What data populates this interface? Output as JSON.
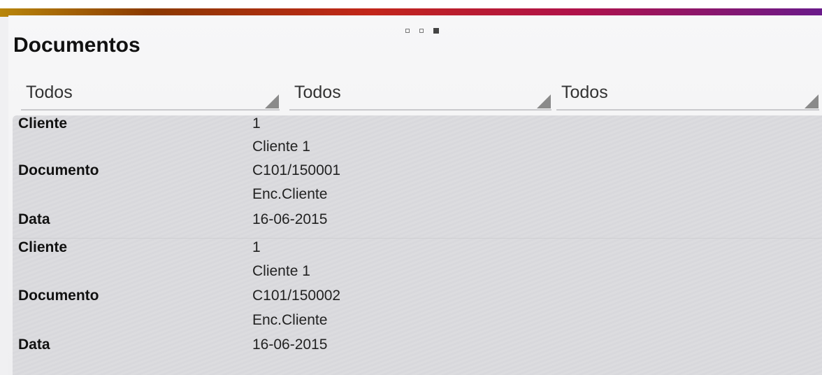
{
  "page_title": "Documentos",
  "filters": [
    "Todos",
    "Todos",
    "Todos"
  ],
  "documents": [
    {
      "cliente_label": "Cliente",
      "cliente_code": "1",
      "cliente_name": "Cliente 1",
      "documento_label": "Documento",
      "documento_number": "C101/150001",
      "documento_type": "Enc.Cliente",
      "data_label": "Data",
      "data_value": "16-06-2015"
    },
    {
      "cliente_label": "Cliente",
      "cliente_code": "1",
      "cliente_name": "Cliente 1",
      "documento_label": "Documento",
      "documento_number": "C101/150002",
      "documento_type": "Enc.Cliente",
      "data_label": "Data",
      "data_value": "16-06-2015"
    }
  ],
  "colors": {
    "accent_gradient": [
      "#b8860b",
      "#c2261a",
      "#6a1a8a"
    ],
    "text": "#111111"
  }
}
